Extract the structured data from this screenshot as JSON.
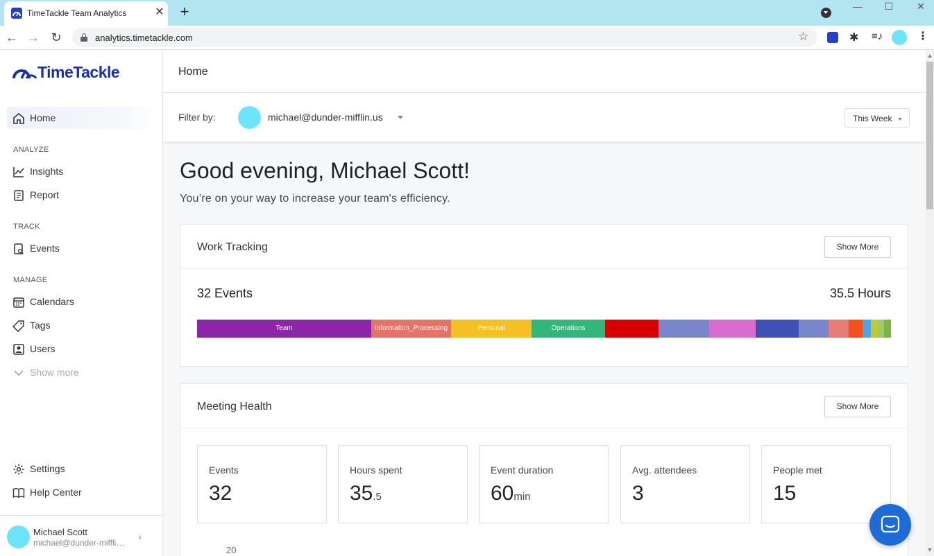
{
  "browser": {
    "tab_title": "TimeTackle Team Analytics",
    "tab_close": "✕",
    "new_tab": "+",
    "back": "←",
    "forward": "→",
    "reload": "↻",
    "url": "analytics.timetackle.com",
    "star": "☆",
    "extensions_icon": "✱",
    "media_icon": "≡♪",
    "menu_icon": "⋮",
    "win_minimize": "—",
    "win_maximize": "☐",
    "win_close": "✕"
  },
  "sidebar": {
    "logo_text": "TimeTackle",
    "home": "Home",
    "section_analyze": "ANALYZE",
    "insights": "Insights",
    "report": "Report",
    "section_track": "TRACK",
    "events": "Events",
    "section_manage": "MANAGE",
    "calendars": "Calendars",
    "tags": "Tags",
    "users": "Users",
    "show_more": "Show more",
    "settings": "Settings",
    "help_center": "Help Center",
    "user_name": "Michael Scott",
    "user_email": "michael@dunder-mifflin.us",
    "user_chevron": "›"
  },
  "header": {
    "title": "Home"
  },
  "filter": {
    "label": "Filter by:",
    "email": "michael@dunder-mifflin.us",
    "period": "This Week"
  },
  "greeting": {
    "title": "Good evening, Michael Scott!",
    "subtitle": "You’re on your way to increase your team's efficiency."
  },
  "work_tracking": {
    "title": "Work Tracking",
    "show_more": "Show More",
    "events": "32 Events",
    "hours": "35.5 Hours",
    "segments": [
      {
        "label": "Team",
        "fraction": 0.251,
        "color": "#8e24aa"
      },
      {
        "label": "Information_Processing",
        "fraction": 0.115,
        "color": "#e57368"
      },
      {
        "label": "Personal",
        "fraction": 0.116,
        "color": "#f6bf26"
      },
      {
        "label": "Operations",
        "fraction": 0.106,
        "color": "#33b679"
      },
      {
        "label": "",
        "fraction": 0.077,
        "color": "#d50000"
      },
      {
        "label": "",
        "fraction": 0.073,
        "color": "#7986cb"
      },
      {
        "label": "",
        "fraction": 0.067,
        "color": "#da6bd0"
      },
      {
        "label": "",
        "fraction": 0.062,
        "color": "#3f51b5"
      },
      {
        "label": "",
        "fraction": 0.043,
        "color": "#7986cb"
      },
      {
        "label": "",
        "fraction": 0.029,
        "color": "#e67c73"
      },
      {
        "label": "",
        "fraction": 0.02,
        "color": "#f4511e"
      },
      {
        "label": "",
        "fraction": 0.012,
        "color": "#4da6e0"
      },
      {
        "label": "",
        "fraction": 0.01,
        "color": "#c0ca33"
      },
      {
        "label": "",
        "fraction": 0.009,
        "color": "#9ccc65"
      },
      {
        "label": "",
        "fraction": 0.01,
        "color": "#7cb342"
      }
    ]
  },
  "meeting_health": {
    "title": "Meeting Health",
    "show_more": "Show More",
    "stats": [
      {
        "label": "Events",
        "value": "32",
        "unit": ""
      },
      {
        "label": "Hours spent",
        "value": "35",
        "unit": ".5"
      },
      {
        "label": "Event duration",
        "value": "60",
        "unit": "min"
      },
      {
        "label": "Avg. attendees",
        "value": "3",
        "unit": ""
      },
      {
        "label": "People met",
        "value": "15",
        "unit": ""
      }
    ],
    "axis_tick": "20"
  },
  "colors": {
    "brand": "#1b2fa8",
    "accent": "#1e6bd6",
    "avatar": "#6ee4fb",
    "tab_strip": "#b3e5f0"
  }
}
